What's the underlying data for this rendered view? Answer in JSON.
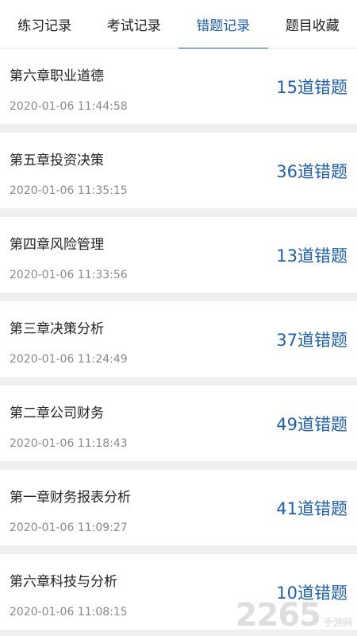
{
  "tabs": [
    {
      "label": "练习记录",
      "active": false
    },
    {
      "label": "考试记录",
      "active": false
    },
    {
      "label": "错题记录",
      "active": true
    },
    {
      "label": "题目收藏",
      "active": false
    }
  ],
  "records": [
    {
      "title": "第六章职业道德",
      "time": "2020-01-06 11:44:58",
      "count": "15道错题"
    },
    {
      "title": "第五章投资决策",
      "time": "2020-01-06 11:35:15",
      "count": "36道错题"
    },
    {
      "title": "第四章风险管理",
      "time": "2020-01-06 11:33:56",
      "count": "13道错题"
    },
    {
      "title": "第三章决策分析",
      "time": "2020-01-06 11:24:49",
      "count": "37道错题"
    },
    {
      "title": "第二章公司财务",
      "time": "2020-01-06 11:18:43",
      "count": "49道错题"
    },
    {
      "title": "第一章财务报表分析",
      "time": "2020-01-06 11:09:27",
      "count": "41道错题"
    },
    {
      "title": "第六章科技与分析",
      "time": "2020-01-06 11:08:15",
      "count": "10道错题"
    }
  ],
  "watermark": {
    "number": "2265",
    "text": "手游网"
  },
  "colors": {
    "accent": "#1e5fb4",
    "text": "#222222",
    "muted": "#8a8a8a",
    "background": "#efefef"
  }
}
